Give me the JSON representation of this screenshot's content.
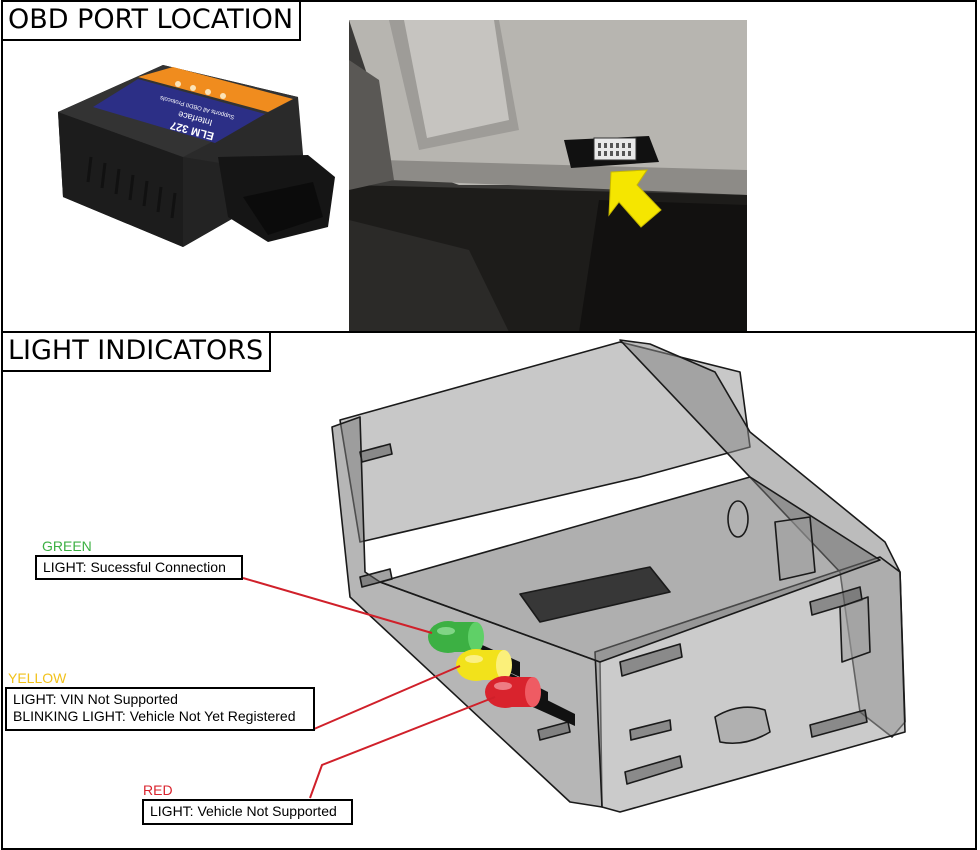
{
  "sections": {
    "port_location": {
      "title": "OBD PORT LOCATION"
    },
    "light_indicators": {
      "title": "LIGHT INDICATORS"
    }
  },
  "adapter": {
    "brand": "ELM 327",
    "line1": "Interface",
    "line2": "Supports All OBDII Protocols"
  },
  "indicators": [
    {
      "color_name": "GREEN",
      "color_hex": "#3cb043",
      "lines": [
        "LIGHT: Sucessful Connection"
      ]
    },
    {
      "color_name": "YELLOW",
      "color_hex": "#f2c21b",
      "lines": [
        "LIGHT: VIN Not Supported",
        "BLINKING LIGHT: Vehicle Not Yet Registered"
      ]
    },
    {
      "color_name": "RED",
      "color_hex": "#d9232d",
      "lines": [
        "LIGHT: Vehicle Not Supported"
      ]
    }
  ],
  "colors": {
    "leader_line": "#d0202a",
    "arrow": "#f5e600",
    "adapter_stripe": "#f08c1e",
    "adapter_label": "#2c2f86"
  }
}
